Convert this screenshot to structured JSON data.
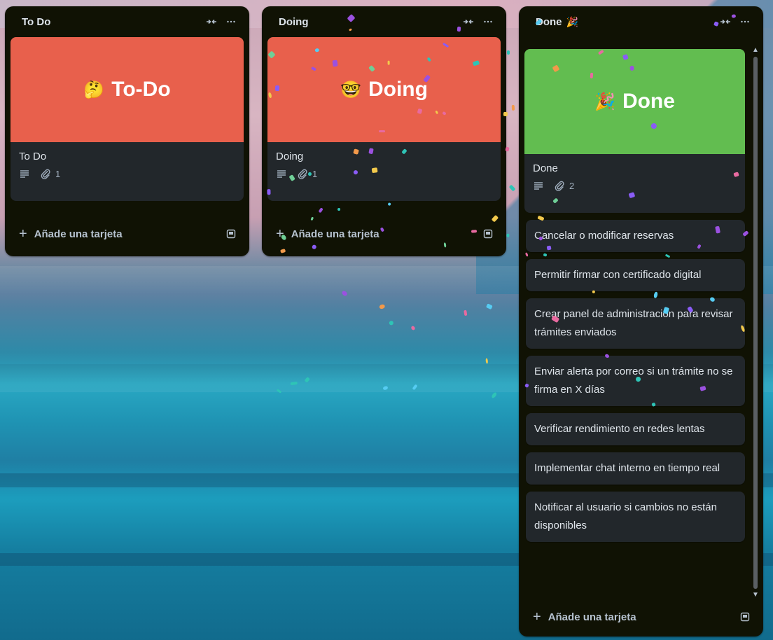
{
  "board": {
    "lists": [
      {
        "title": "To Do",
        "title_emoji": "",
        "cover_card": {
          "cover_color": "#e8604c",
          "cover_emoji": "🤔",
          "cover_text": "To-Do",
          "title": "To Do",
          "attachments": "1"
        },
        "cards": [],
        "add_card_label": "Añade una tarjeta"
      },
      {
        "title": "Doing",
        "title_emoji": "",
        "cover_card": {
          "cover_color": "#e8604c",
          "cover_emoji": "🤓",
          "cover_text": "Doing",
          "title": "Doing",
          "attachments": "1"
        },
        "cards": [],
        "add_card_label": "Añade una tarjeta"
      },
      {
        "title": "Done",
        "title_emoji": "🎉",
        "cover_card": {
          "cover_color": "#62bd50",
          "cover_emoji": "🎉",
          "cover_text": "Done",
          "title": "Done",
          "attachments": "2"
        },
        "cards": [
          "Cancelar o modificar reservas",
          "Permitir firmar con certificado digital",
          "Crear panel de administración para revisar trámites enviados",
          "Enviar alerta por correo si un trámite no se firma en X días",
          "Verificar rendimiento en redes lentas",
          "Implementar chat interno en tiempo real",
          "Notificar al usuario si cambios no están disponibles"
        ],
        "add_card_label": "Añade una tarjeta"
      }
    ],
    "header_icons": [
      "collapse-icon",
      "more-icon"
    ],
    "badge_icons": [
      "description-icon",
      "attachment-icon"
    ]
  }
}
